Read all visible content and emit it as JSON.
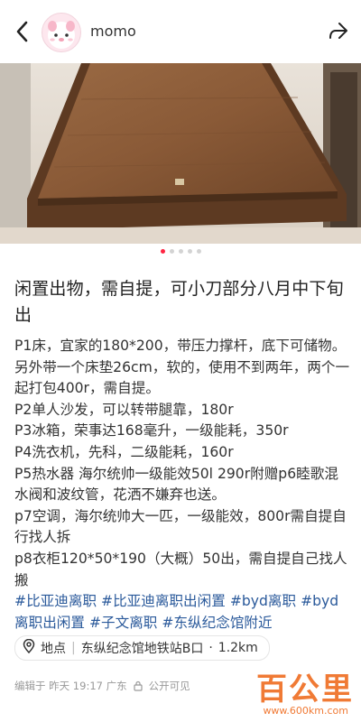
{
  "header": {
    "username": "momo"
  },
  "carousel": {
    "current": 1,
    "total": 5
  },
  "post": {
    "title": "闲置出物，需自提，可小刀部分八月中下旬出",
    "lines": [
      "P1床，宜家的180*200，带压力撑杆，底下可储物。另外带一个床垫26cm，软的，使用不到两年，两个一起打包400r，需自提。",
      "P2单人沙发，可以转带腿靠，180r",
      "P3冰箱，荣事达168毫升，一级能耗，350r",
      "P4洗衣机，先科，二级能耗，160r",
      "P5热水器 海尔统帅一级能效50l 290r附赠p6睦歌混水阀和波纹管，花洒不嫌弃也送。",
      "p7空调，海尔统帅大一匹，一级能效，800r需自提自行找人拆",
      "p8衣柜120*50*190（大概）50出，需自提自己找人搬"
    ],
    "tags": [
      "#比亚迪离职",
      "#比亚迪离职出闲置",
      "#byd离职",
      "#byd离职出闲置",
      "#子文离职",
      "#东纵纪念馆附近"
    ]
  },
  "location": {
    "label": "地点",
    "place": "东纵纪念馆地铁站B口",
    "distance": "1.2km"
  },
  "meta": {
    "edited": "编辑于 昨天 19:17 广东",
    "visibility": "公开可见"
  },
  "watermark": {
    "brand": "百公里",
    "url": "www.600km.com"
  },
  "colors": {
    "accent": "#ff2442",
    "tag": "#2b5a9b",
    "watermark": "#f07a35"
  }
}
